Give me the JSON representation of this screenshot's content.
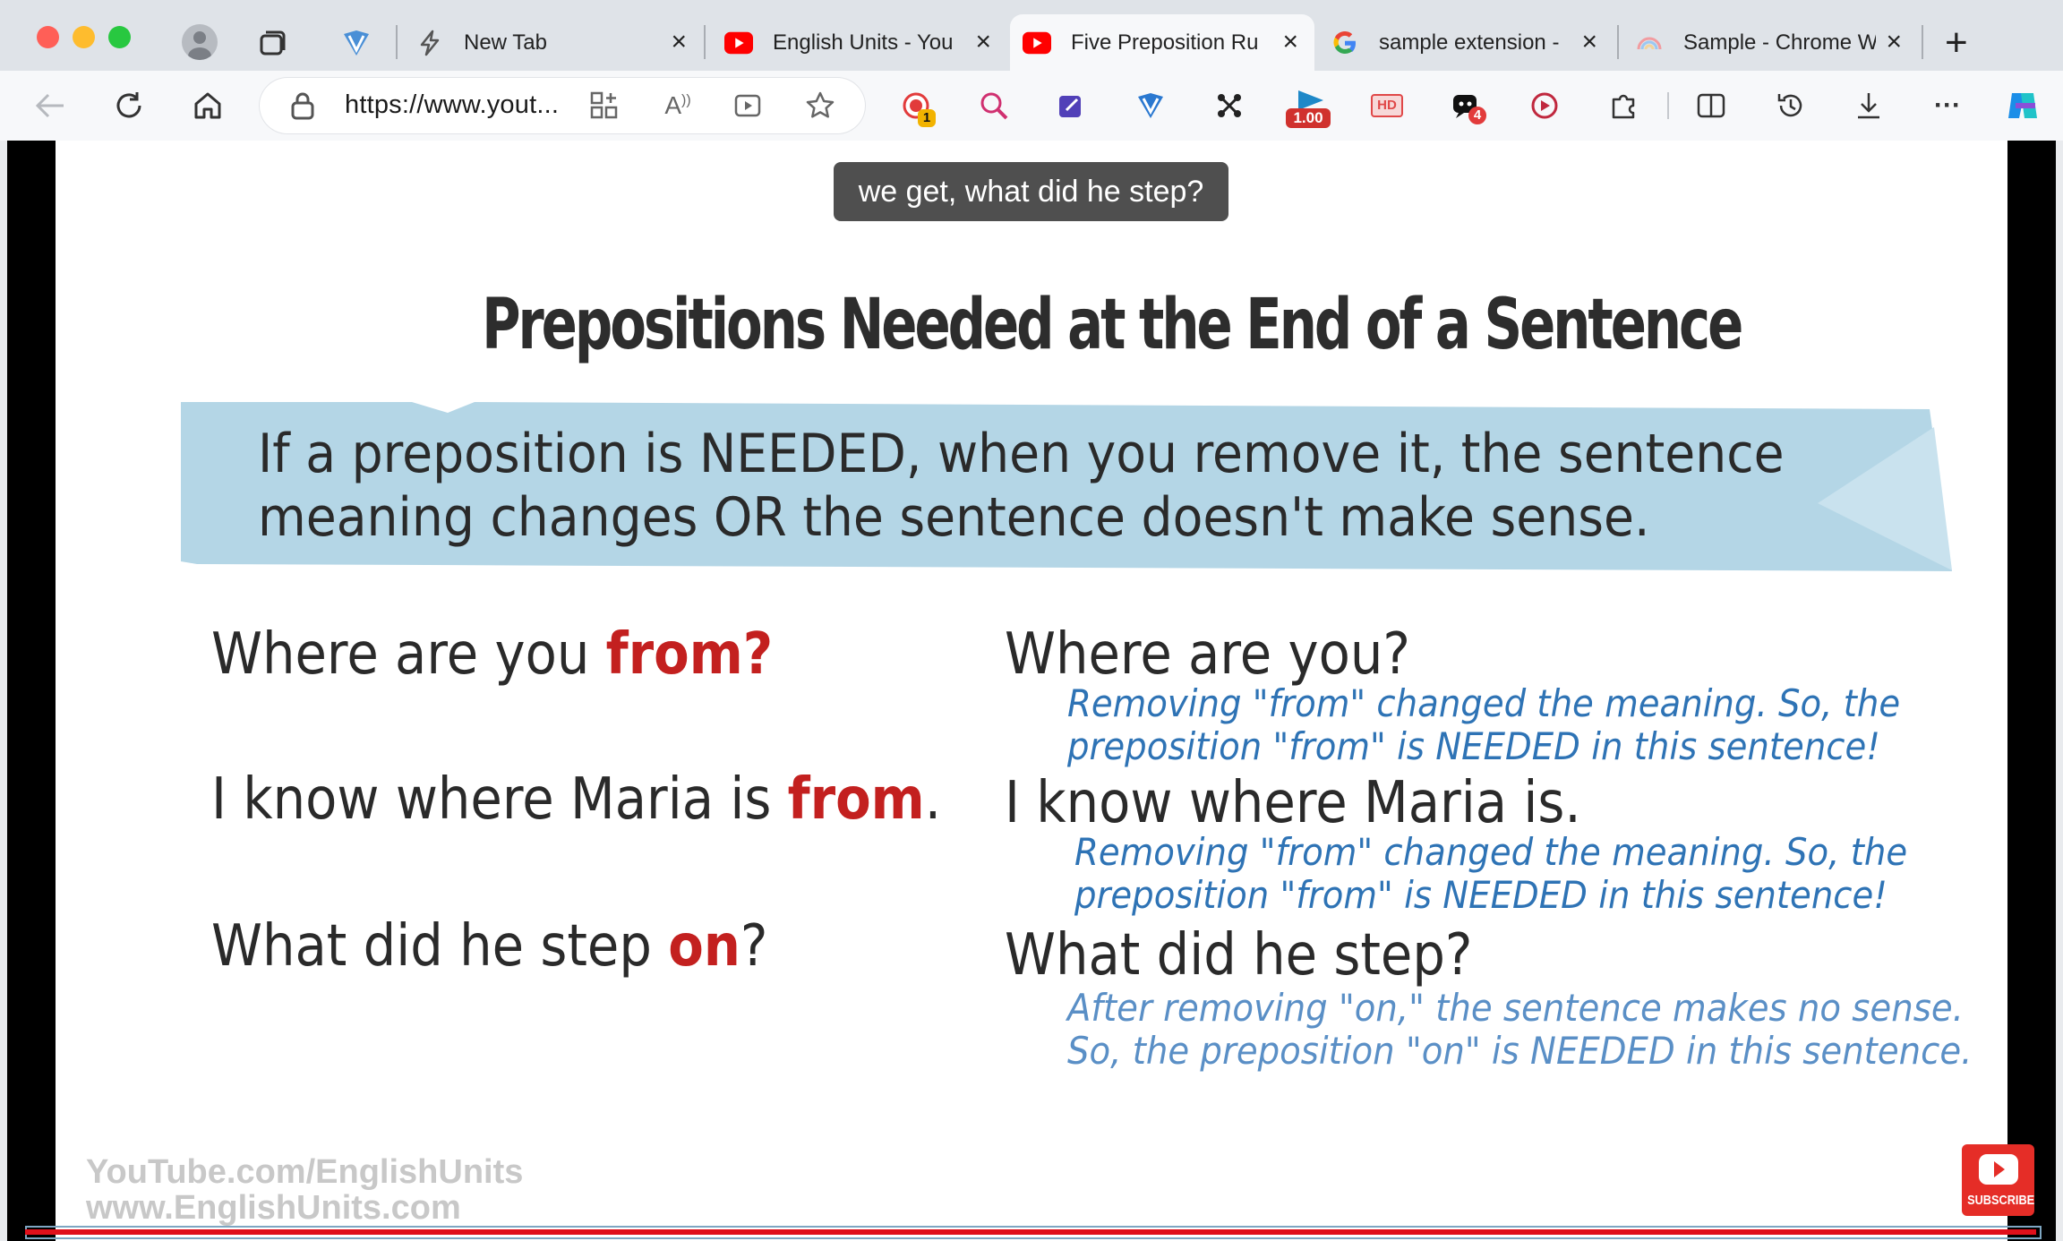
{
  "tabs": [
    {
      "title": "New Tab",
      "icon": "lightning-icon"
    },
    {
      "title": "English Units - You",
      "icon": "youtube-icon"
    },
    {
      "title": "Five Preposition Ru",
      "icon": "youtube-icon",
      "active": true
    },
    {
      "title": "sample extension -",
      "icon": "google-icon"
    },
    {
      "title": "Sample - Chrome W",
      "icon": "rainbow-icon"
    }
  ],
  "toolbar": {
    "url": "https://www.yout...",
    "ext_badges": {
      "rec": "1",
      "speed": "1.00",
      "hd": "HD",
      "count": "4"
    }
  },
  "caption": "we get, what did he step?",
  "slide": {
    "heading": "Prepositions Needed at the End of a Sentence",
    "banner_line1": "If a preposition is NEEDED, when you remove it, the sentence",
    "banner_line2": "meaning changes OR the sentence doesn't make sense.",
    "examples": [
      {
        "pre": "Where are you ",
        "prep": "from?",
        "post": "",
        "short": "Where are you?",
        "note1": "Removing \"from\" changed the meaning. So, the",
        "note2": "preposition \"from\" is NEEDED in this sentence!"
      },
      {
        "pre": "I know where Maria is ",
        "prep": "from",
        "post": ".",
        "short": "I know where Maria is.",
        "note1": "Removing \"from\" changed the meaning. So, the",
        "note2": "preposition \"from\" is NEEDED in this sentence!"
      },
      {
        "pre": "What did he step ",
        "prep": "on",
        "post": "?",
        "short": "What did he step?",
        "note1": "After removing \"on,\" the sentence makes no sense.",
        "note2": "So, the preposition \"on\" is NEEDED in this sentence."
      }
    ],
    "watermark1": "YouTube.com/EnglishUnits",
    "watermark2": "www.EnglishUnits.com",
    "subscribe": "SUBSCRIBE"
  }
}
